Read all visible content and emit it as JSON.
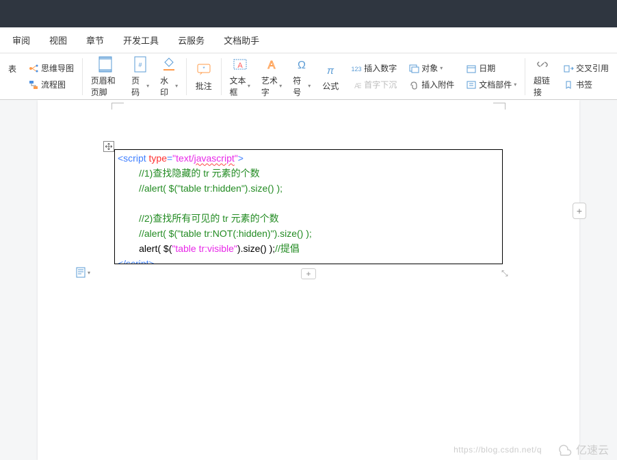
{
  "menubar": [
    "审阅",
    "视图",
    "章节",
    "开发工具",
    "云服务",
    "文档助手"
  ],
  "ribbon": {
    "g1": {
      "a": "思维导图",
      "b": "流程图",
      "c": "表"
    },
    "header_footer": "页眉和页脚",
    "page_num": "页码",
    "watermark": "水印",
    "comment": "批注",
    "textbox": "文本框",
    "wordart": "艺术字",
    "symbol": "符号",
    "formula": "公式",
    "insert_num": "插入数字",
    "dropcap": "首字下沉",
    "object": "对象",
    "attach": "插入附件",
    "date": "日期",
    "docparts": "文档部件",
    "hyperlink": "超链接",
    "xref": "交叉引用",
    "bookmark": "书签"
  },
  "code": {
    "line1_a": "<script ",
    "line1_b": "type",
    "line1_c": "=",
    "line1_d": "\"text/",
    "line1_e": "javascript",
    "line1_f": "\"",
    "line1_g": ">",
    "line2": "        //1)查找隐藏的 tr 元素的个数",
    "line3": "        //alert( $(\"table tr:hidden\").size() );",
    "line4": "",
    "line5": "        //2)查找所有可见的 tr 元素的个数",
    "line6": "        //alert( $(\"table tr:NOT(:hidden)\").size() );",
    "line7_a": "        alert( $(",
    "line7_b": "\"table tr:visible\"",
    "line7_c": ").size() );",
    "line7_d": "//提倡",
    "line8": "</script>"
  },
  "watermark_url": "https://blog.csdn.net/q",
  "watermark_brand": "亿速云"
}
